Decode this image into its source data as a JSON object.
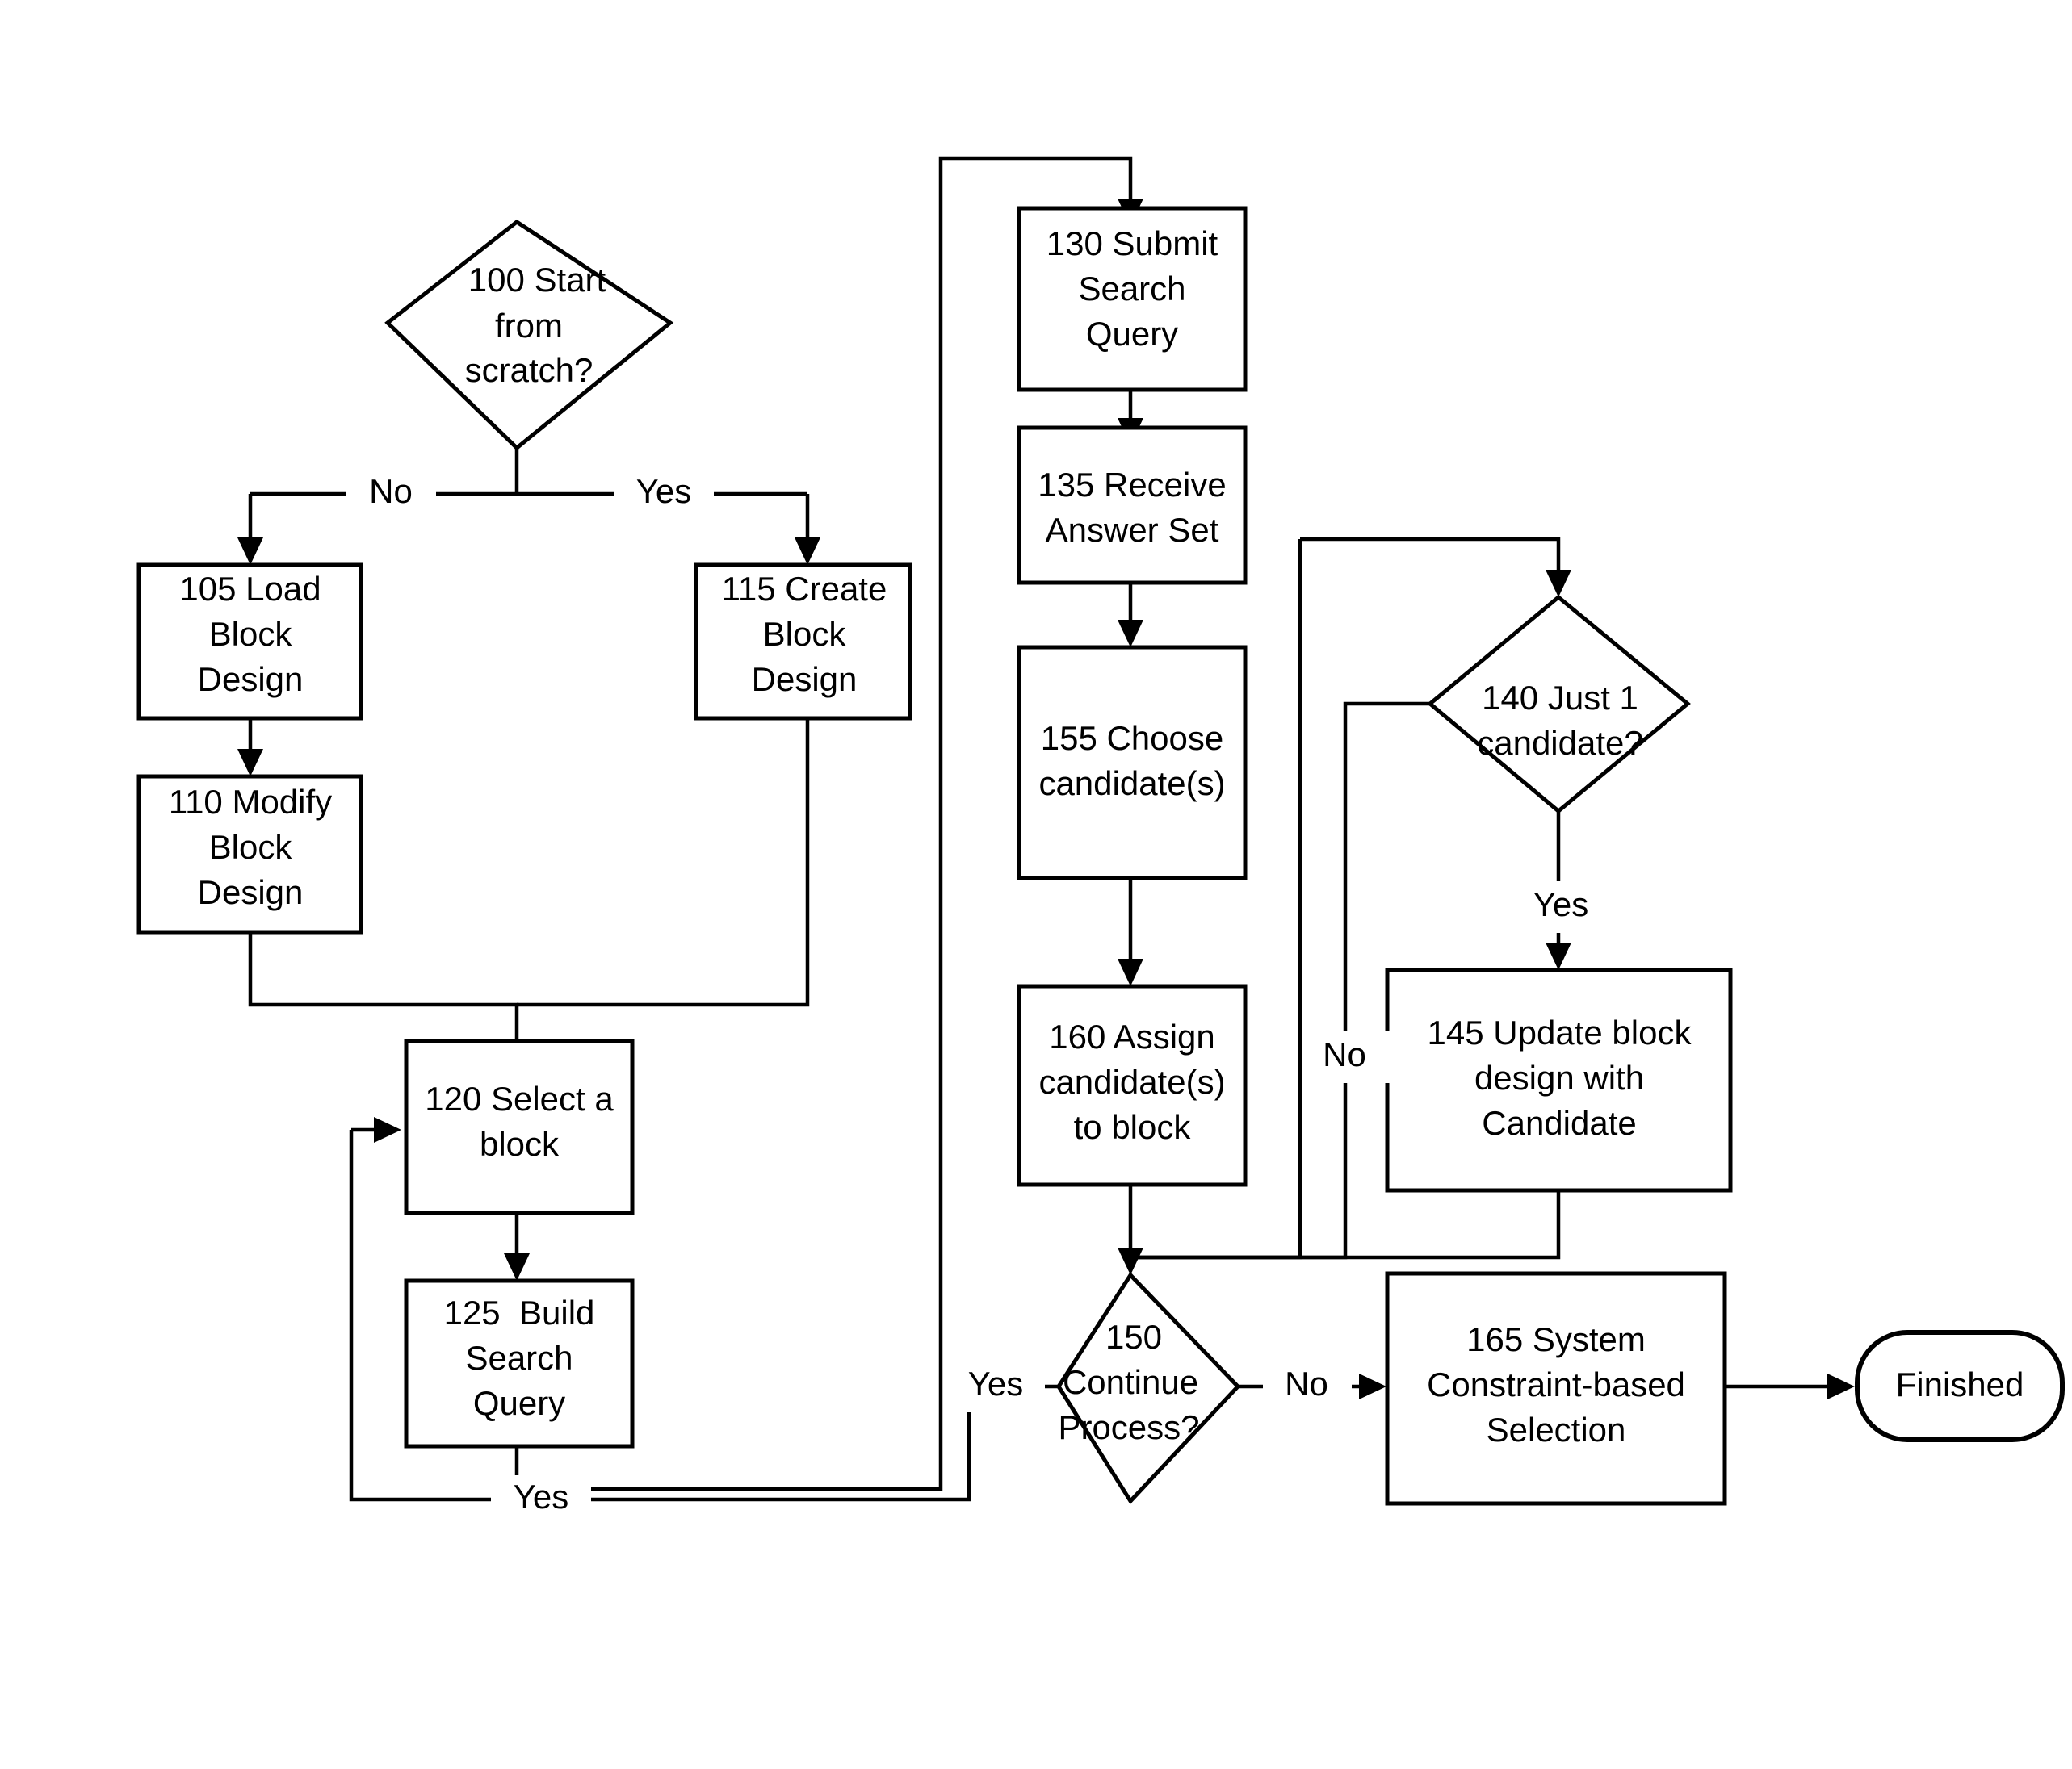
{
  "diagram": {
    "title": "Block design search and candidate selection flowchart",
    "background_color": "#ffffff",
    "line_color": "#000000",
    "text_color": "#000000",
    "nodes": {
      "n100": {
        "id": "100",
        "shape": "decision",
        "line1": "100 Start",
        "line2": "from",
        "line3": "scratch?"
      },
      "n105": {
        "id": "105",
        "shape": "process",
        "line1": "105 Load",
        "line2": "Block",
        "line3": "Design"
      },
      "n110": {
        "id": "110",
        "shape": "process",
        "line1": "110 Modify",
        "line2": "Block",
        "line3": "Design"
      },
      "n115": {
        "id": "115",
        "shape": "process",
        "line1": "115 Create",
        "line2": "Block",
        "line3": "Design"
      },
      "n120": {
        "id": "120",
        "shape": "process",
        "line1": "120 Select a",
        "line2": "block",
        "line3": ""
      },
      "n125": {
        "id": "125",
        "shape": "process",
        "line1": "125  Build",
        "line2": "Search",
        "line3": "Query"
      },
      "n130": {
        "id": "130",
        "shape": "process",
        "line1": "130 Submit",
        "line2": "Search",
        "line3": "Query"
      },
      "n135": {
        "id": "135",
        "shape": "process",
        "line1": "135 Receive",
        "line2": "Answer Set",
        "line3": ""
      },
      "n140": {
        "id": "140",
        "shape": "decision",
        "line1": "140 Just 1",
        "line2": "candidate?",
        "line3": ""
      },
      "n145": {
        "id": "145",
        "shape": "process",
        "line1": "145 Update block",
        "line2": "design with",
        "line3": "Candidate"
      },
      "n150": {
        "id": "150",
        "shape": "decision",
        "line1": "150",
        "line2": "Continue",
        "line3": "Process?"
      },
      "n155": {
        "id": "155",
        "shape": "process",
        "line1": "155 Choose",
        "line2": "candidate(s)",
        "line3": ""
      },
      "n160": {
        "id": "160",
        "shape": "process",
        "line1": "160 Assign",
        "line2": "candidate(s)",
        "line3": "to block"
      },
      "n165": {
        "id": "165",
        "shape": "process",
        "line1": "165 System",
        "line2": "Constraint-based",
        "line3": "Selection"
      },
      "nFinished": {
        "id": "finished",
        "shape": "terminator",
        "line1": "Finished",
        "line2": "",
        "line3": ""
      }
    },
    "edge_labels": {
      "start_no": "No",
      "start_yes": "Yes",
      "just1_yes": "Yes",
      "just1_no": "No",
      "continue_yes": "Yes",
      "continue_no": "No",
      "loop_yes": "Yes"
    }
  }
}
